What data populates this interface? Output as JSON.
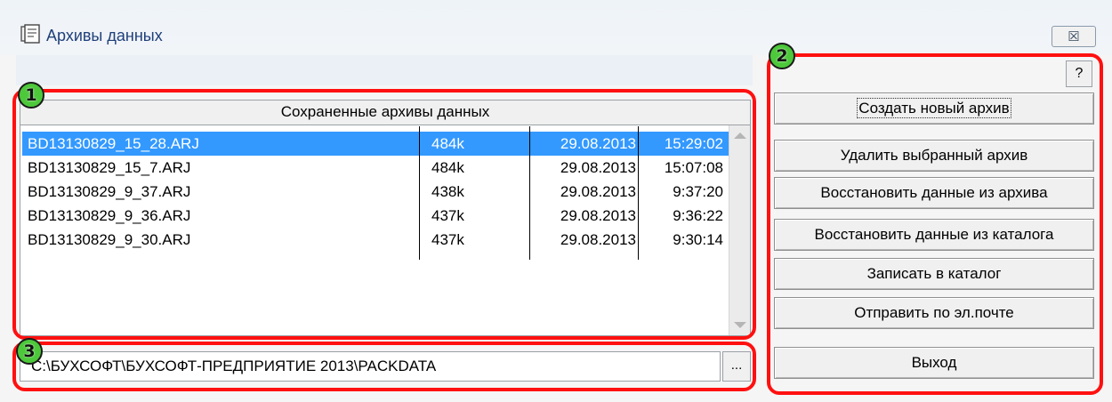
{
  "window": {
    "title": "Архивы данных",
    "close_label": "☒"
  },
  "list": {
    "header": "Сохраненные архивы данных",
    "rows": [
      {
        "name": "BD13130829_15_28.ARJ",
        "size": "484k",
        "date": "29.08.2013",
        "time": "15:29:02",
        "selected": true
      },
      {
        "name": "BD13130829_15_7.ARJ",
        "size": "484k",
        "date": "29.08.2013",
        "time": "15:07:08",
        "selected": false
      },
      {
        "name": "BD13130829_9_37.ARJ",
        "size": "438k",
        "date": "29.08.2013",
        "time": "9:37:20",
        "selected": false
      },
      {
        "name": "BD13130829_9_36.ARJ",
        "size": "437k",
        "date": "29.08.2013",
        "time": "9:36:22",
        "selected": false
      },
      {
        "name": "BD13130829_9_30.ARJ",
        "size": "437k",
        "date": "29.08.2013",
        "time": "9:30:14",
        "selected": false
      }
    ]
  },
  "path": {
    "value": "C:\\БУХСОФТ\\БУХСОФТ-ПРЕДПРИЯТИЕ 2013\\PACKDATA",
    "browse_label": "..."
  },
  "buttons": {
    "help": "?",
    "create": "Создать новый архив",
    "delete": "Удалить выбранный архив",
    "restore_archive": "Восстановить данные из архива",
    "restore_catalog": "Восстановить данные из каталога",
    "write_catalog": "Записать в каталог",
    "send_email": "Отправить по эл.почте",
    "exit": "Выход"
  },
  "annotations": {
    "badge1": "1",
    "badge2": "2",
    "badge3": "3",
    "highlight_color": "#ff1010",
    "badge_color": "#4cc83a"
  },
  "colors": {
    "selection": "#3399ff",
    "title_text": "#1f3f7a"
  }
}
